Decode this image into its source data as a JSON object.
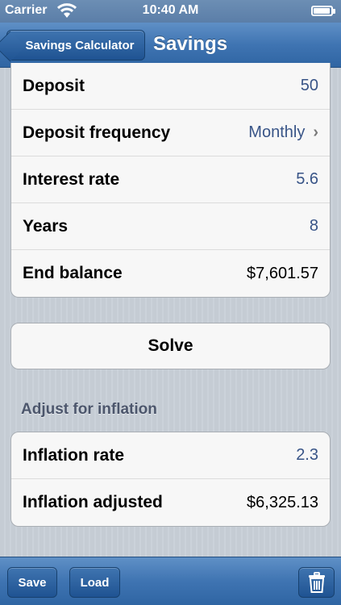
{
  "status_bar": {
    "carrier": "Carrier",
    "time": "10:40 AM",
    "icons": [
      "wifi-icon",
      "battery-icon"
    ]
  },
  "nav": {
    "back_label": "Savings Calculator",
    "title": "Savings"
  },
  "calculator": {
    "rows": [
      {
        "label": "Deposit",
        "value": "50"
      },
      {
        "label": "Deposit frequency",
        "value": "Monthly",
        "icon": "chevron-right-icon"
      },
      {
        "label": "Interest rate",
        "value": "5.6"
      },
      {
        "label": "Years",
        "value": "8"
      },
      {
        "label": "End balance",
        "value": "$7,601.57"
      }
    ],
    "solve_label": "Solve"
  },
  "inflation": {
    "header": "Adjust for inflation",
    "rows": [
      {
        "label": "Inflation rate",
        "value": "2.3"
      },
      {
        "label": "Inflation adjusted",
        "value": "$6,325.13"
      }
    ]
  },
  "toolbar": {
    "save_label": "Save",
    "load_label": "Load",
    "trash_icon": "trash-icon"
  },
  "colors": {
    "bar_blue": "#3f74b2",
    "value_blue": "#385487",
    "background": "#c5ccd4"
  }
}
